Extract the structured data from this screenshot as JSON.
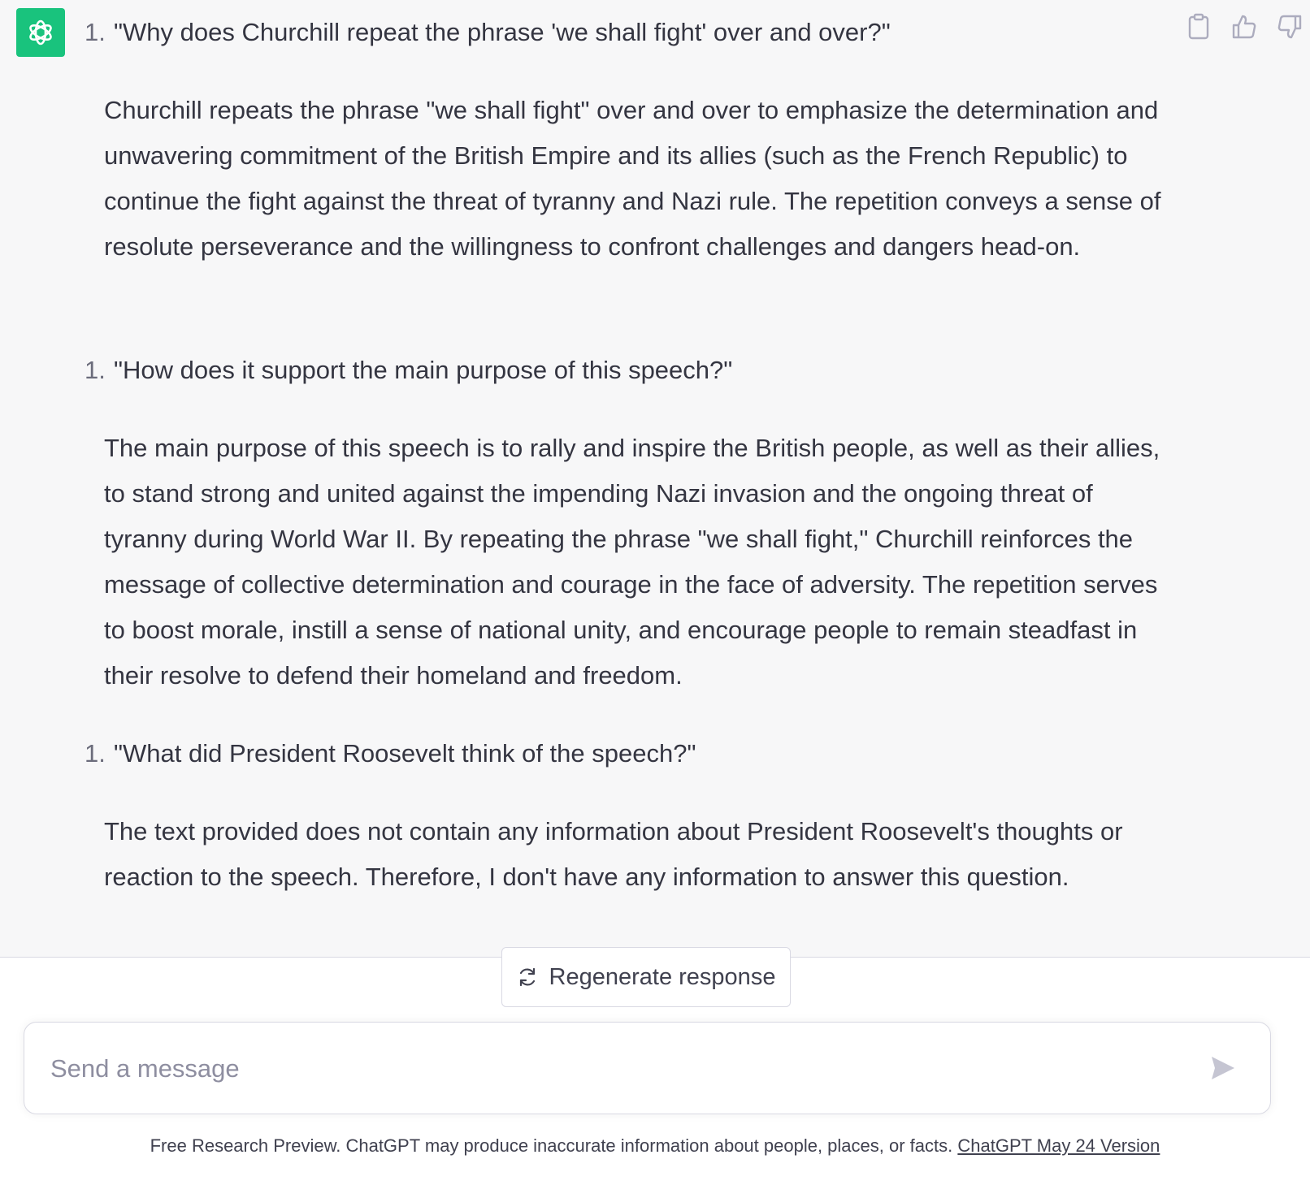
{
  "conversation": {
    "items": [
      {
        "number": "1.",
        "question": "\"Why does Churchill repeat the phrase 'we shall fight' over and over?\"",
        "answer": "Churchill repeats the phrase \"we shall fight\" over and over to emphasize the determination and unwavering commitment of the British Empire and its allies (such as the French Republic) to continue the fight against the threat of tyranny and Nazi rule. The repetition conveys a sense of resolute perseverance and the willingness to confront challenges and dangers head-on."
      },
      {
        "number": "1.",
        "question": "\"How does it support the main purpose of this speech?\"",
        "answer": "The main purpose of this speech is to rally and inspire the British people, as well as their allies, to stand strong and united against the impending Nazi invasion and the ongoing threat of tyranny during World War II. By repeating the phrase \"we shall fight,\" Churchill reinforces the message of collective determination and courage in the face of adversity. The repetition serves to boost morale, instill a sense of national unity, and encourage people to remain steadfast in their resolve to defend their homeland and freedom."
      },
      {
        "number": "1.",
        "question": "\"What did President Roosevelt think of the speech?\"",
        "answer": "The text provided does not contain any information about President Roosevelt's thoughts or reaction to the speech. Therefore, I don't have any information to answer this question."
      }
    ]
  },
  "icons": {
    "avatar": "openai-logo-icon",
    "copy": "clipboard-icon",
    "like": "thumbs-up-icon",
    "dislike": "thumbs-down-icon",
    "regenerate": "refresh-icon",
    "send": "send-icon"
  },
  "regenerate": {
    "label": "Regenerate response"
  },
  "composer": {
    "placeholder": "Send a message",
    "value": ""
  },
  "footer": {
    "text": "Free Research Preview. ChatGPT may produce inaccurate information about people, places, or facts. ",
    "link": "ChatGPT May 24 Version"
  },
  "colors": {
    "accent": "#19c37d",
    "background": "#f7f7f8",
    "text": "#343541"
  }
}
